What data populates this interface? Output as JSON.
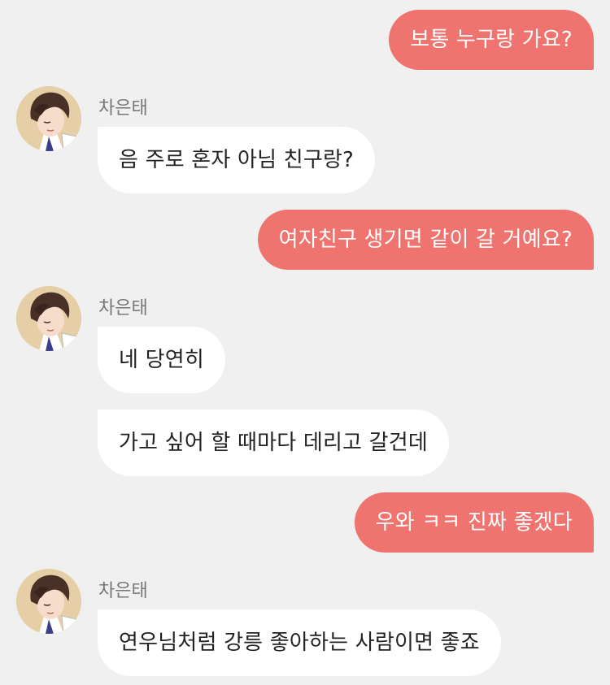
{
  "contact": {
    "name": "차은태"
  },
  "messages": [
    {
      "from": "me",
      "text": "보통 누구랑 가요?"
    },
    {
      "from": "them",
      "text": "음 주로 혼자 아님 친구랑?"
    },
    {
      "from": "me",
      "text": "여자친구 생기면 같이 갈 거예요?"
    },
    {
      "from": "them",
      "text": "네 당연히"
    },
    {
      "from": "them",
      "text": "가고 싶어 할 때마다 데리고 갈건데"
    },
    {
      "from": "me",
      "text": "우와 ㅋㅋ 진짜 좋겠다"
    },
    {
      "from": "them",
      "text": "연우님처럼 강릉 좋아하는 사람이면 좋죠"
    }
  ],
  "colors": {
    "me_bubble": "#ef736e",
    "them_bubble": "#ffffff",
    "background": "#f0f0f0"
  }
}
